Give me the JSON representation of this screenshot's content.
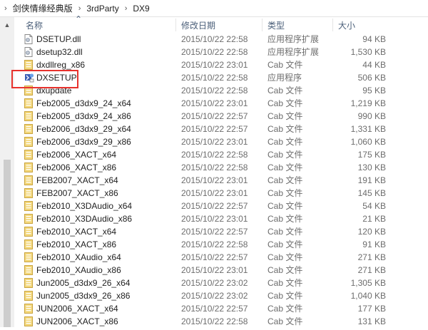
{
  "breadcrumb": {
    "items": [
      "剑侠情缘经典版",
      "3rdParty",
      "DX9"
    ]
  },
  "columns": {
    "name": "名称",
    "date": "修改日期",
    "type": "类型",
    "size": "大小"
  },
  "files": [
    {
      "name": "DSETUP.dll",
      "date": "2015/10/22 22:58",
      "type": "应用程序扩展",
      "size": "94 KB",
      "icon": "dll-file-icon"
    },
    {
      "name": "dsetup32.dll",
      "date": "2015/10/22 22:58",
      "type": "应用程序扩展",
      "size": "1,530 KB",
      "icon": "dll-file-icon"
    },
    {
      "name": "dxdllreg_x86",
      "date": "2015/10/22 23:01",
      "type": "Cab 文件",
      "size": "44 KB",
      "icon": "cab-file-icon"
    },
    {
      "name": "DXSETUP",
      "date": "2015/10/22 22:58",
      "type": "应用程序",
      "size": "506 KB",
      "icon": "setup-exe-icon"
    },
    {
      "name": "dxupdate",
      "date": "2015/10/22 22:58",
      "type": "Cab 文件",
      "size": "95 KB",
      "icon": "cab-file-icon"
    },
    {
      "name": "Feb2005_d3dx9_24_x64",
      "date": "2015/10/22 23:01",
      "type": "Cab 文件",
      "size": "1,219 KB",
      "icon": "cab-file-icon"
    },
    {
      "name": "Feb2005_d3dx9_24_x86",
      "date": "2015/10/22 22:57",
      "type": "Cab 文件",
      "size": "990 KB",
      "icon": "cab-file-icon"
    },
    {
      "name": "Feb2006_d3dx9_29_x64",
      "date": "2015/10/22 22:57",
      "type": "Cab 文件",
      "size": "1,331 KB",
      "icon": "cab-file-icon"
    },
    {
      "name": "Feb2006_d3dx9_29_x86",
      "date": "2015/10/22 23:01",
      "type": "Cab 文件",
      "size": "1,060 KB",
      "icon": "cab-file-icon"
    },
    {
      "name": "Feb2006_XACT_x64",
      "date": "2015/10/22 22:58",
      "type": "Cab 文件",
      "size": "175 KB",
      "icon": "cab-file-icon"
    },
    {
      "name": "Feb2006_XACT_x86",
      "date": "2015/10/22 22:58",
      "type": "Cab 文件",
      "size": "130 KB",
      "icon": "cab-file-icon"
    },
    {
      "name": "FEB2007_XACT_x64",
      "date": "2015/10/22 23:01",
      "type": "Cab 文件",
      "size": "191 KB",
      "icon": "cab-file-icon"
    },
    {
      "name": "FEB2007_XACT_x86",
      "date": "2015/10/22 23:01",
      "type": "Cab 文件",
      "size": "145 KB",
      "icon": "cab-file-icon"
    },
    {
      "name": "Feb2010_X3DAudio_x64",
      "date": "2015/10/22 22:57",
      "type": "Cab 文件",
      "size": "54 KB",
      "icon": "cab-file-icon"
    },
    {
      "name": "Feb2010_X3DAudio_x86",
      "date": "2015/10/22 23:01",
      "type": "Cab 文件",
      "size": "21 KB",
      "icon": "cab-file-icon"
    },
    {
      "name": "Feb2010_XACT_x64",
      "date": "2015/10/22 22:57",
      "type": "Cab 文件",
      "size": "120 KB",
      "icon": "cab-file-icon"
    },
    {
      "name": "Feb2010_XACT_x86",
      "date": "2015/10/22 22:58",
      "type": "Cab 文件",
      "size": "91 KB",
      "icon": "cab-file-icon"
    },
    {
      "name": "Feb2010_XAudio_x64",
      "date": "2015/10/22 22:57",
      "type": "Cab 文件",
      "size": "271 KB",
      "icon": "cab-file-icon"
    },
    {
      "name": "Feb2010_XAudio_x86",
      "date": "2015/10/22 23:01",
      "type": "Cab 文件",
      "size": "271 KB",
      "icon": "cab-file-icon"
    },
    {
      "name": "Jun2005_d3dx9_26_x64",
      "date": "2015/10/22 23:02",
      "type": "Cab 文件",
      "size": "1,305 KB",
      "icon": "cab-file-icon"
    },
    {
      "name": "Jun2005_d3dx9_26_x86",
      "date": "2015/10/22 23:02",
      "type": "Cab 文件",
      "size": "1,040 KB",
      "icon": "cab-file-icon"
    },
    {
      "name": "JUN2006_XACT_x64",
      "date": "2015/10/22 22:57",
      "type": "Cab 文件",
      "size": "177 KB",
      "icon": "cab-file-icon"
    },
    {
      "name": "JUN2006_XACT_x86",
      "date": "2015/10/22 22:58",
      "type": "Cab 文件",
      "size": "131 KB",
      "icon": "cab-file-icon"
    }
  ],
  "highlighted_file": "DXSETUP",
  "colors": {
    "highlight_border": "#e8322d",
    "header_text": "#4c607a",
    "meta_text": "#6d6d6d",
    "cab_icon": "#e9c55a"
  }
}
